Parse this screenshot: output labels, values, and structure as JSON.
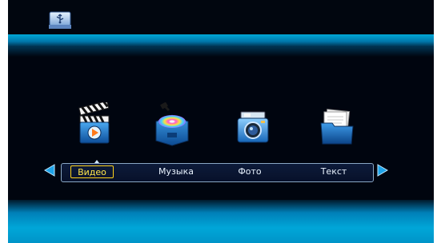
{
  "header": {
    "icon": "usb-drive-icon"
  },
  "media_icons": [
    {
      "name": "video-clapper-icon"
    },
    {
      "name": "music-disc-icon"
    },
    {
      "name": "photo-camera-icon"
    },
    {
      "name": "text-documents-icon"
    }
  ],
  "menu": {
    "items": [
      {
        "label": "Видео",
        "selected": true
      },
      {
        "label": "Музыка",
        "selected": false
      },
      {
        "label": "Фото",
        "selected": false
      },
      {
        "label": "Текст",
        "selected": false
      }
    ],
    "left_arrow": "arrow-left-icon",
    "right_arrow": "arrow-right-icon"
  },
  "colors": {
    "background": "#00050f",
    "accent_band": "#00a6d8",
    "selected_text": "#ffe64c",
    "menu_text": "#e9f3ff"
  }
}
